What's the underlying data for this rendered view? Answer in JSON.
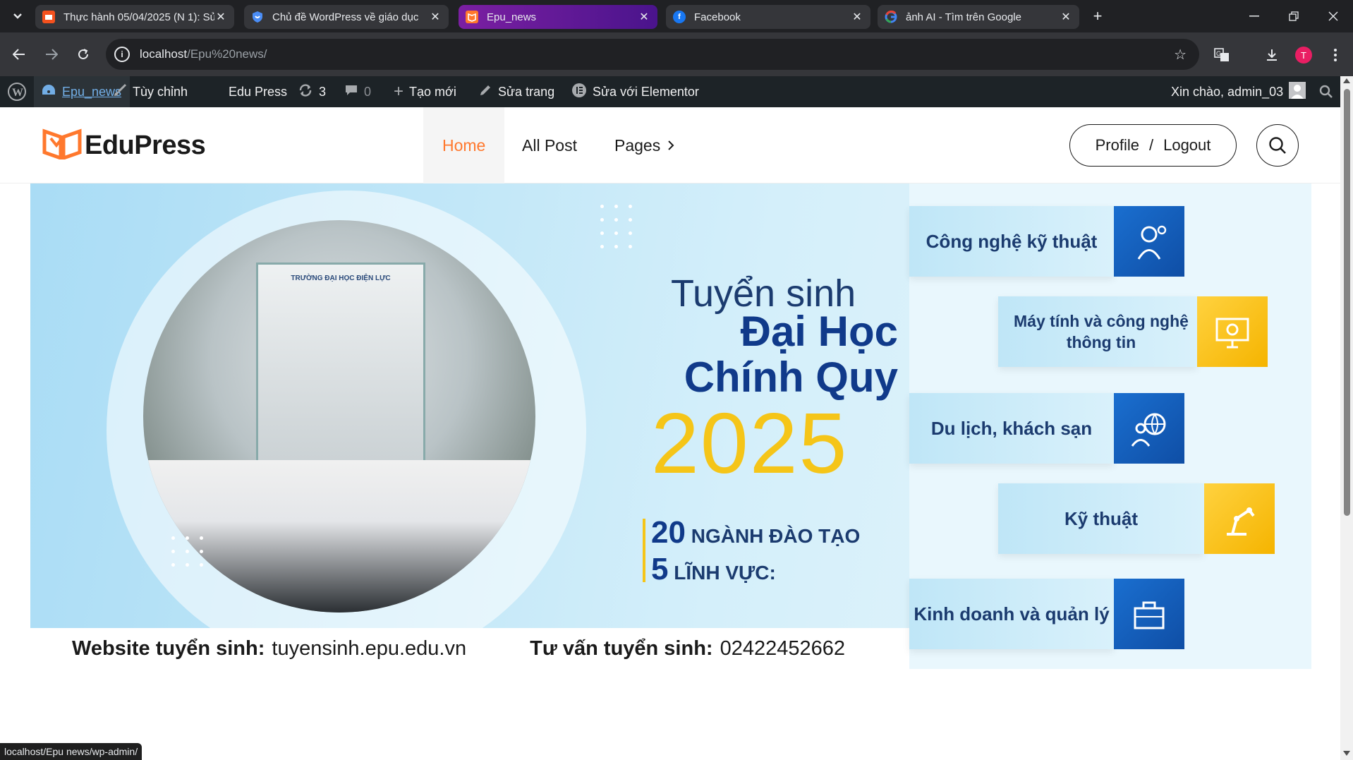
{
  "browser": {
    "tabs": [
      {
        "title": "Thực hành 05/04/2025 (N 1): Sử",
        "icon": "slides-icon",
        "color": "#f4511e"
      },
      {
        "title": "Chủ đề WordPress về giáo dục",
        "icon": "shield-icon",
        "color": "#1a73e8"
      },
      {
        "title": "Epu_news",
        "icon": "edupress-icon",
        "color": "#ff782d",
        "active": true
      },
      {
        "title": "Facebook",
        "icon": "facebook-icon",
        "color": "#1877f2"
      },
      {
        "title": "ảnh AI - Tìm trên Google",
        "icon": "google-icon",
        "color": "#ffffff"
      }
    ],
    "url_host": "localhost",
    "url_path": "/Epu%20news/",
    "profile_initial": "T"
  },
  "adminbar": {
    "site_name": "Epu_news",
    "customize": "Tùy chỉnh",
    "theme": "Edu Press",
    "updates_count": "3",
    "comments_count": "0",
    "new": "Tạo mới",
    "edit_page": "Sửa trang",
    "elementor": "Sửa với Elementor",
    "greeting": "Xin chào, admin_03"
  },
  "site": {
    "logo_text": "EduPress",
    "menu": {
      "home": "Home",
      "all_post": "All Post",
      "pages": "Pages"
    },
    "profile": "Profile",
    "separator": "/",
    "logout": "Logout"
  },
  "banner": {
    "building_sign": "TRƯỜNG ĐẠI HỌC ĐIỆN LỰC",
    "line1": "Tuyển sinh",
    "line2": "Đại Học",
    "line3": "Chính Quy",
    "year": "2025",
    "stat1_num": "20",
    "stat1_text": "NGÀNH ĐÀO TẠO",
    "stat2_num": "5",
    "stat2_text": "LĨNH VỰC:",
    "website_label": "Website tuyển sinh:",
    "website_value": "tuyensinh.epu.edu.vn",
    "hotline_label": "Tư vấn tuyển sinh:",
    "hotline_value": "02422452662",
    "categories": [
      {
        "label": "Công nghệ kỹ thuật",
        "icon": "engineer-icon",
        "color": "blue"
      },
      {
        "label": "Máy tính và công nghệ thông tin",
        "icon": "computer-gear-icon",
        "color": "yellow"
      },
      {
        "label": "Du lịch, khách sạn",
        "icon": "globe-traveler-icon",
        "color": "blue"
      },
      {
        "label": "Kỹ thuật",
        "icon": "robot-arm-icon",
        "color": "yellow"
      },
      {
        "label": "Kinh doanh và quản lý",
        "icon": "briefcase-icon",
        "color": "blue"
      }
    ]
  },
  "statusbar": {
    "text": "localhost/Epu news/wp-admin/"
  }
}
